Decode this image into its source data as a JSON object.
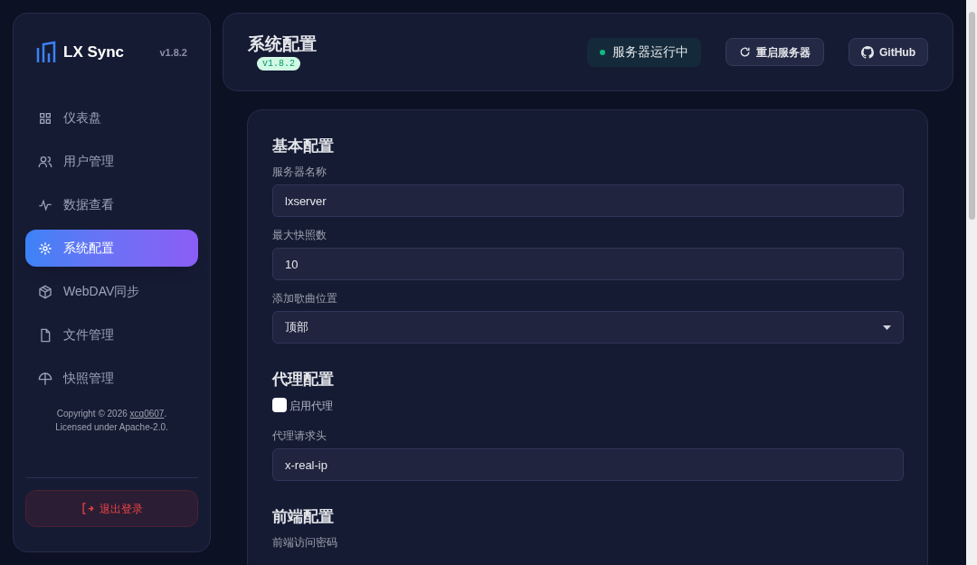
{
  "sidebar": {
    "brand": "LX Sync",
    "version": "v1.8.2",
    "items": [
      {
        "label": "仪表盘",
        "selected": false
      },
      {
        "label": "用户管理",
        "selected": false
      },
      {
        "label": "数据查看",
        "selected": false
      },
      {
        "label": "系统配置",
        "selected": true
      },
      {
        "label": "WebDAV同步",
        "selected": false
      },
      {
        "label": "文件管理",
        "selected": false
      },
      {
        "label": "快照管理",
        "selected": false
      }
    ],
    "copyright": "Copyright © 2026 ",
    "author": "xcq0607",
    "copyright_end": ".",
    "license": "Licensed under Apache-2.0.",
    "logout": "退出登录"
  },
  "header": {
    "title": "系统配置",
    "version": "v1.8.2",
    "status": "服务器运行中",
    "restart": "重启服务器",
    "github": "GitHub"
  },
  "form": [
    {
      "kind": "section",
      "label": "基本配置"
    },
    {
      "kind": "text",
      "label": "服务器名称",
      "value": "lxserver"
    },
    {
      "kind": "text",
      "label": "最大快照数",
      "value": "10"
    },
    {
      "kind": "select",
      "label": "添加歌曲位置",
      "value": "顶部"
    },
    {
      "kind": "section",
      "label": "代理配置"
    },
    {
      "kind": "checkbox",
      "label": "启用代理",
      "checked": false
    },
    {
      "kind": "text",
      "label": "代理请求头",
      "value": "x-real-ip"
    },
    {
      "kind": "section",
      "label": "前端配置"
    },
    {
      "kind": "label",
      "label": "前端访问密码"
    }
  ]
}
